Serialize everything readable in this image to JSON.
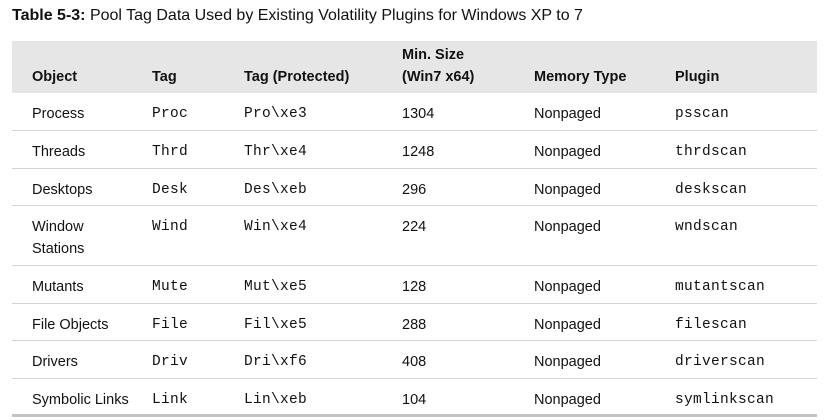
{
  "caption": {
    "label": "Table 5-3:",
    "title": "Pool Tag Data Used by Existing Volatility Plugins for Windows XP to 7"
  },
  "headers": {
    "object": "Object",
    "tag": "Tag",
    "tag_protected": "Tag (Protected)",
    "min_size_line1": "Min. Size",
    "min_size_line2": "(Win7 x64)",
    "memory_type": "Memory Type",
    "plugin": "Plugin"
  },
  "rows": [
    {
      "object": "Process",
      "tag": "Proc",
      "tag_protected": "Pro\\xe3",
      "min_size": "1304",
      "memory_type": "Nonpaged",
      "plugin": "psscan"
    },
    {
      "object": "Threads",
      "tag": "Thrd",
      "tag_protected": "Thr\\xe4",
      "min_size": "1248",
      "memory_type": "Nonpaged",
      "plugin": "thrdscan"
    },
    {
      "object": "Desktops",
      "tag": "Desk",
      "tag_protected": "Des\\xeb",
      "min_size": "296",
      "memory_type": "Nonpaged",
      "plugin": "deskscan"
    },
    {
      "object_line1": "Window",
      "object_line2": "Stations",
      "tag": "Wind",
      "tag_protected": "Win\\xe4",
      "min_size": "224",
      "memory_type": "Nonpaged",
      "plugin": "wndscan"
    },
    {
      "object": "Mutants",
      "tag": "Mute",
      "tag_protected": "Mut\\xe5",
      "min_size": "128",
      "memory_type": "Nonpaged",
      "plugin": "mutantscan"
    },
    {
      "object": "File Objects",
      "tag": "File",
      "tag_protected": "Fil\\xe5",
      "min_size": "288",
      "memory_type": "Nonpaged",
      "plugin": "filescan"
    },
    {
      "object": "Drivers",
      "tag": "Driv",
      "tag_protected": "Dri\\xf6",
      "min_size": "408",
      "memory_type": "Nonpaged",
      "plugin": "driverscan"
    },
    {
      "object": "Symbolic Links",
      "tag": "Link",
      "tag_protected": "Lin\\xeb",
      "min_size": "104",
      "memory_type": "Nonpaged",
      "plugin": "symlinkscan"
    }
  ]
}
